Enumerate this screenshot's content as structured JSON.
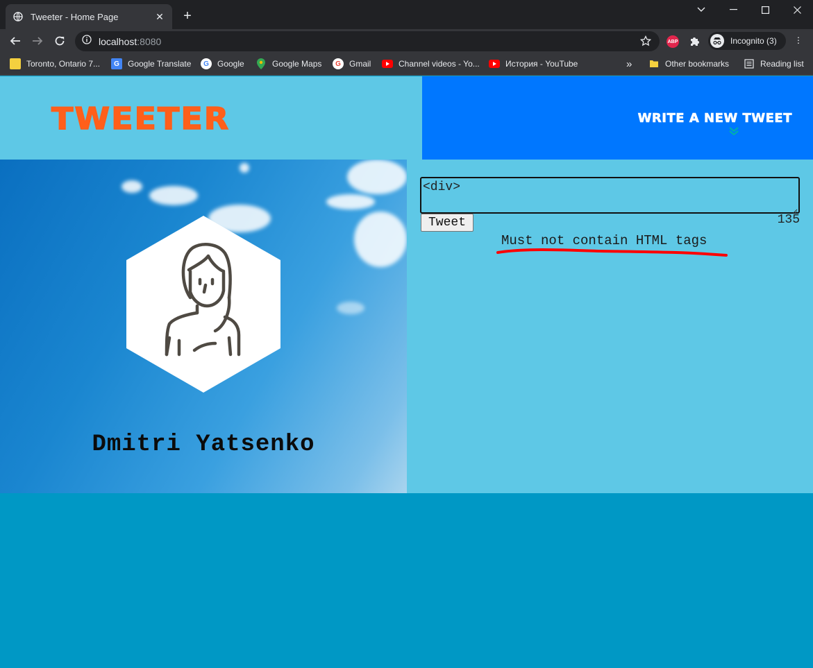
{
  "browser": {
    "tab_title": "Tweeter - Home Page",
    "url_host": "localhost",
    "url_port": ":8080",
    "abp_label": "ABP",
    "profile_label": "Incognito (3)",
    "bookmarks": [
      {
        "label": "Toronto, Ontario 7...",
        "icon": "weather-icon"
      },
      {
        "label": "Google Translate",
        "icon": "translate-icon"
      },
      {
        "label": "Google",
        "icon": "google-icon"
      },
      {
        "label": "Google Maps",
        "icon": "maps-icon"
      },
      {
        "label": "Gmail",
        "icon": "google-icon"
      },
      {
        "label": "Channel videos - Yo...",
        "icon": "youtube-icon"
      },
      {
        "label": "История - YouTube",
        "icon": "youtube-icon"
      }
    ],
    "overflow_label": "»",
    "other_bookmarks": "Other bookmarks",
    "reading_list": "Reading list"
  },
  "header": {
    "logo": "TWEETER",
    "write_new_tweet": "WRITE A NEW TWEET"
  },
  "profile": {
    "name": "Dmitri Yatsenko"
  },
  "composer": {
    "input_value": "<div>",
    "tweet_button": "Tweet",
    "char_count": "135",
    "error_message": "Must not contain HTML tags"
  },
  "colors": {
    "header_bg": "#5ec8e6",
    "write_box_bg": "#0077ff",
    "logo": "#ff5f1a",
    "page_bg": "#0098c5",
    "error_underline": "#ff0000"
  }
}
